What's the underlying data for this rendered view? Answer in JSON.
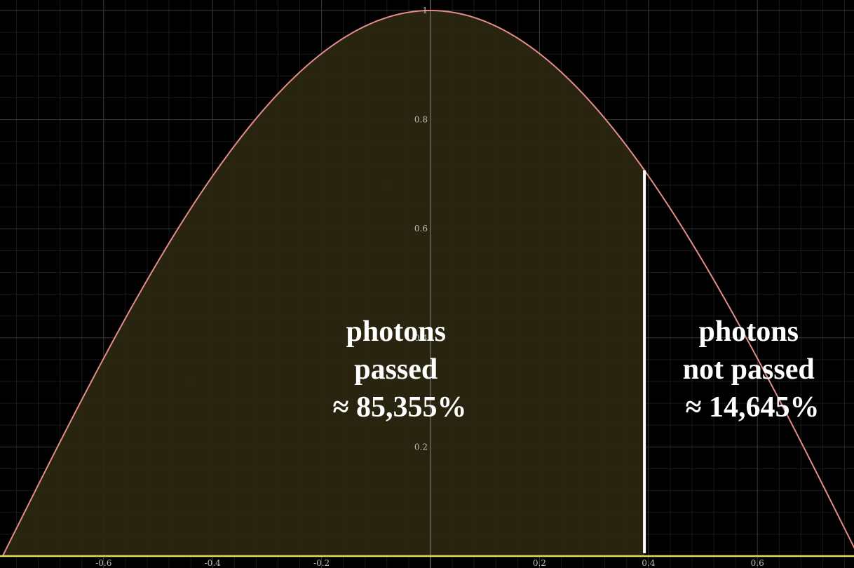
{
  "chart_data": {
    "type": "area",
    "function": "cos(2x)",
    "xlim": [
      -0.785,
      0.785
    ],
    "ylim": [
      0,
      1
    ],
    "x_ticks": [
      "-0.6",
      "-0.4",
      "-0.2",
      "0.2",
      "0.4",
      "0.6"
    ],
    "x_tick_values": [
      -0.6,
      -0.4,
      -0.2,
      0.2,
      0.4,
      0.6
    ],
    "y_ticks": [
      "0.2",
      "0.4",
      "0.6",
      "0.8",
      "1"
    ],
    "y_tick_values": [
      0.2,
      0.4,
      0.6,
      0.8,
      1
    ],
    "cutoff_x": 0.3927,
    "grid": true,
    "colors": {
      "background": "#000000",
      "curve": "#e58c8c",
      "fill": "#2c2711",
      "x_axis": "#dede5a",
      "grid_major": "#3a3a3a",
      "grid_minor": "#1b1b1b",
      "cutoff_line": "#ffffff"
    },
    "annotations": {
      "passed": {
        "lines": [
          "photons",
          "passed",
          "≈ 85,355%"
        ]
      },
      "not_passed": {
        "lines": [
          "photons",
          "not passed",
          "≈ 14,645%"
        ]
      }
    }
  }
}
